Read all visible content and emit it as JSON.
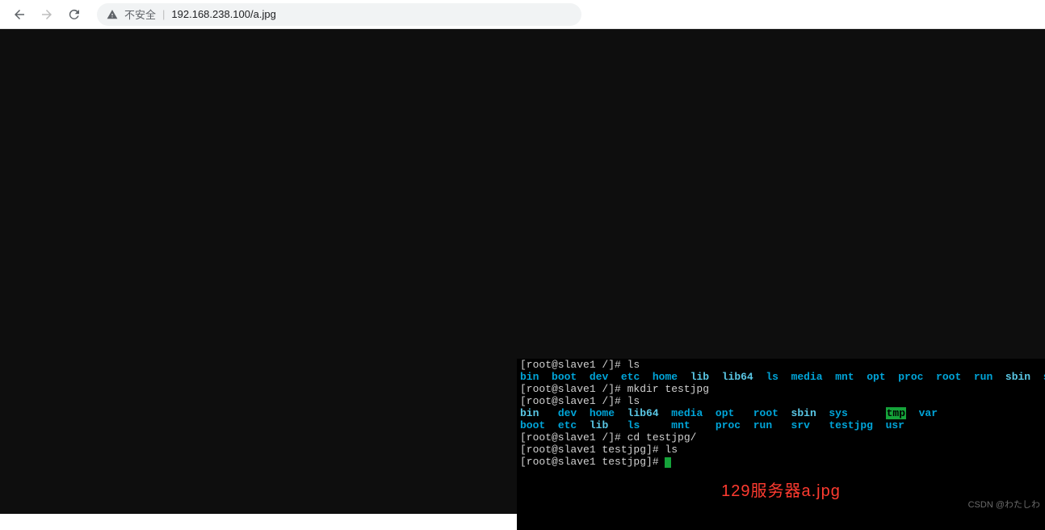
{
  "browser": {
    "insecure_label": "不安全",
    "divider": "|",
    "url": "192.168.238.100/a.jpg"
  },
  "terminal": {
    "line0_prompt": "[root@slave1 /]# ls",
    "ls1": {
      "items": [
        {
          "t": "bin",
          "c": "cyan"
        },
        {
          "t": "  "
        },
        {
          "t": "boot",
          "c": "cyan"
        },
        {
          "t": "  "
        },
        {
          "t": "dev",
          "c": "cyan"
        },
        {
          "t": "  "
        },
        {
          "t": "etc",
          "c": "cyan"
        },
        {
          "t": "  "
        },
        {
          "t": "home",
          "c": "cyan"
        },
        {
          "t": "  "
        },
        {
          "t": "lib",
          "c": "lightcyan"
        },
        {
          "t": "  "
        },
        {
          "t": "lib64",
          "c": "lightcyan"
        },
        {
          "t": "  "
        },
        {
          "t": "ls",
          "c": "cyan"
        },
        {
          "t": "  "
        },
        {
          "t": "media",
          "c": "cyan"
        },
        {
          "t": "  "
        },
        {
          "t": "mnt",
          "c": "cyan"
        },
        {
          "t": "  "
        },
        {
          "t": "opt",
          "c": "cyan"
        },
        {
          "t": "  "
        },
        {
          "t": "proc",
          "c": "cyan"
        },
        {
          "t": "  "
        },
        {
          "t": "root",
          "c": "cyan"
        },
        {
          "t": "  "
        },
        {
          "t": "run",
          "c": "cyan"
        },
        {
          "t": "  "
        },
        {
          "t": "sbin",
          "c": "lightcyan"
        },
        {
          "t": "  "
        },
        {
          "t": "srv",
          "c": "cyan"
        }
      ]
    },
    "line2": "[root@slave1 /]# mkdir testjpg",
    "line3": "[root@slave1 /]# ls",
    "ls2_row1": {
      "items": [
        {
          "t": "bin",
          "c": "lightcyan"
        },
        {
          "t": "   "
        },
        {
          "t": "dev",
          "c": "cyan"
        },
        {
          "t": "  "
        },
        {
          "t": "home",
          "c": "cyan"
        },
        {
          "t": "  "
        },
        {
          "t": "lib64",
          "c": "lightcyan"
        },
        {
          "t": "  "
        },
        {
          "t": "media",
          "c": "cyan"
        },
        {
          "t": "  "
        },
        {
          "t": "opt",
          "c": "cyan"
        },
        {
          "t": "   "
        },
        {
          "t": "root",
          "c": "cyan"
        },
        {
          "t": "  "
        },
        {
          "t": "sbin",
          "c": "lightcyan"
        },
        {
          "t": "  "
        },
        {
          "t": "sys",
          "c": "cyan"
        },
        {
          "t": "      "
        },
        {
          "t": "tmp",
          "c": "tmp"
        },
        {
          "t": "  "
        },
        {
          "t": "var",
          "c": "cyan"
        }
      ]
    },
    "ls2_row2": {
      "items": [
        {
          "t": "boot",
          "c": "cyan"
        },
        {
          "t": "  "
        },
        {
          "t": "etc",
          "c": "cyan"
        },
        {
          "t": "  "
        },
        {
          "t": "lib",
          "c": "lightcyan"
        },
        {
          "t": "   "
        },
        {
          "t": "ls",
          "c": "cyan"
        },
        {
          "t": "     "
        },
        {
          "t": "mnt",
          "c": "cyan"
        },
        {
          "t": "    "
        },
        {
          "t": "proc",
          "c": "cyan"
        },
        {
          "t": "  "
        },
        {
          "t": "run",
          "c": "cyan"
        },
        {
          "t": "   "
        },
        {
          "t": "srv",
          "c": "cyan"
        },
        {
          "t": "   "
        },
        {
          "t": "testjpg",
          "c": "cyan"
        },
        {
          "t": "  "
        },
        {
          "t": "usr",
          "c": "cyan"
        }
      ]
    },
    "line6": "[root@slave1 /]# cd testjpg/",
    "line7": "[root@slave1 testjpg]# ls",
    "line8": "[root@slave1 testjpg]# "
  },
  "caption": "129服务器a.jpg",
  "watermark": "CSDN @わたしわ"
}
